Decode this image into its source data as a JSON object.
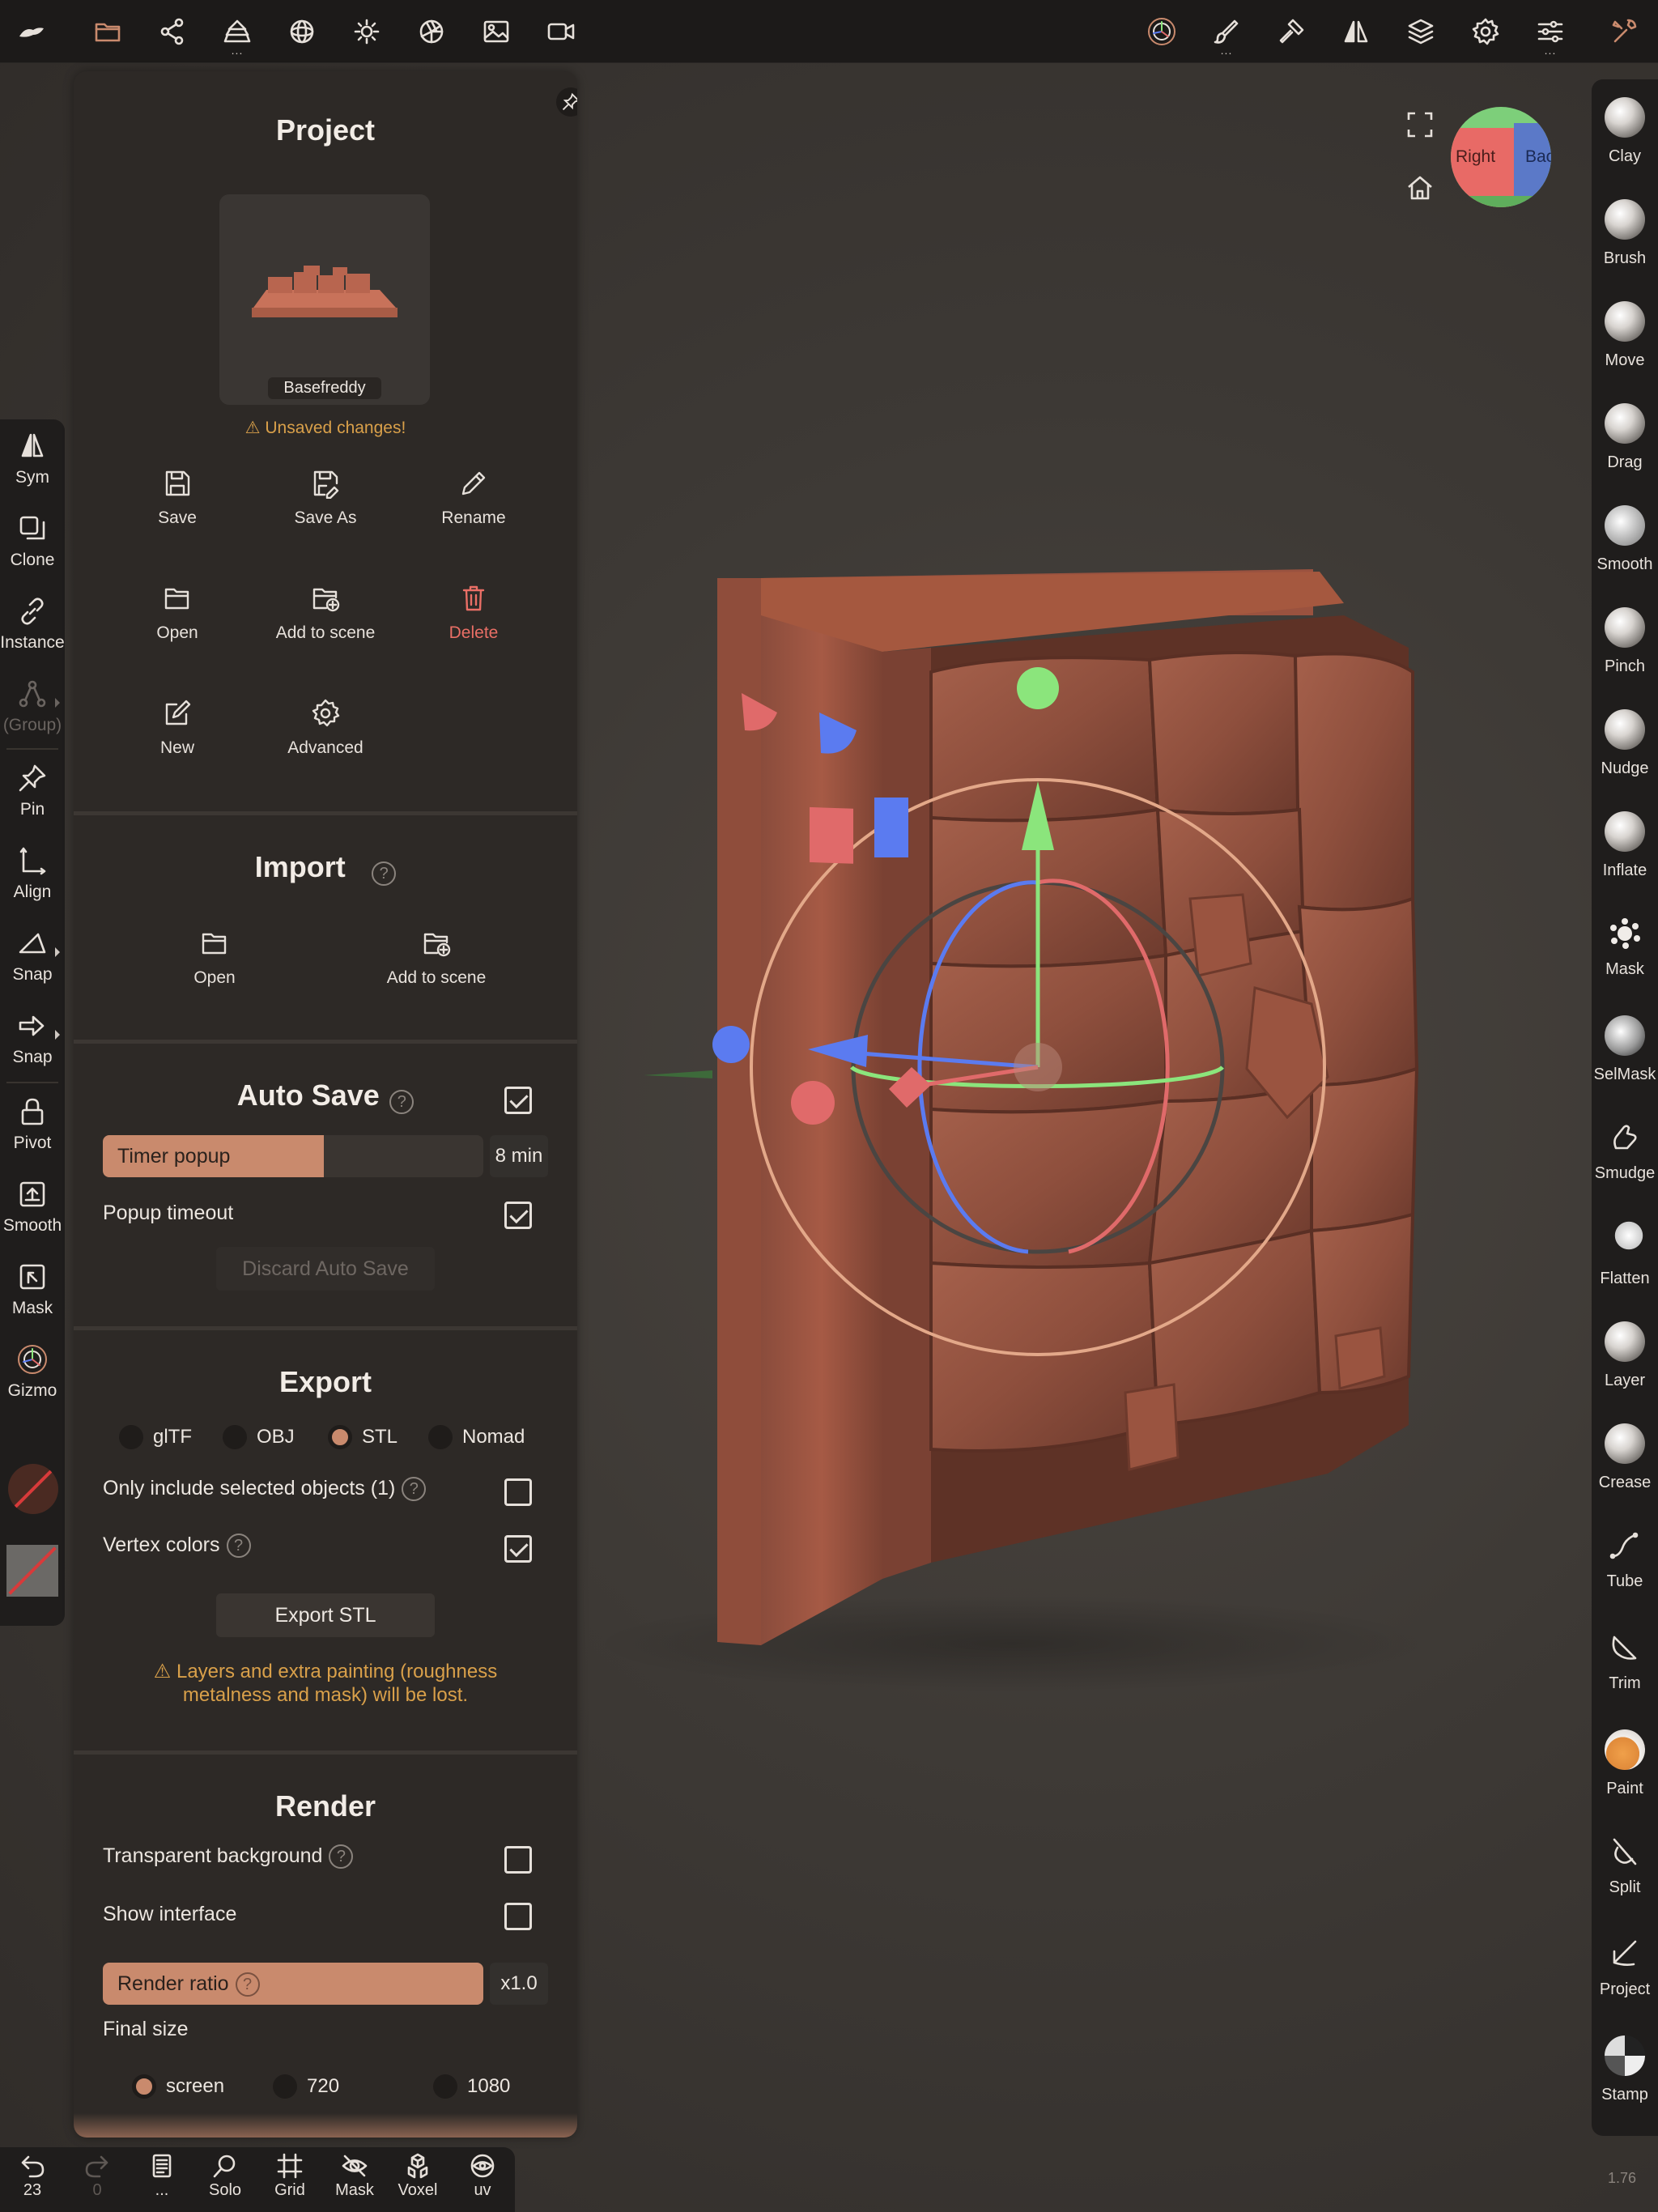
{
  "topbar": {
    "icons": [
      "nomad-logo-icon",
      "folder-icon",
      "scene-graph-icon",
      "layers-stack-icon",
      "material-sphere-icon",
      "light-sun-icon",
      "camera-aperture-icon",
      "image-icon",
      "video-camera-icon",
      "gizmo-icon",
      "paint-brush-icon",
      "sculpt-hammer-icon",
      "symmetry-icon",
      "layers-icon",
      "settings-gear-icon",
      "sliders-icon",
      "tools-icon"
    ]
  },
  "left_rail": {
    "items": [
      {
        "label": "Sym",
        "icon": "symmetry-icon"
      },
      {
        "label": "Clone",
        "icon": "clone-icon"
      },
      {
        "label": "Instance",
        "icon": "link-icon"
      },
      {
        "label": "(Group)",
        "icon": "group-icon"
      },
      {
        "label": "Pin",
        "icon": "pin-icon"
      },
      {
        "label": "Align",
        "icon": "align-icon"
      },
      {
        "label": "Snap",
        "icon": "snap-angle-icon"
      },
      {
        "label": "Snap",
        "icon": "snap-arrow-icon"
      },
      {
        "label": "Pivot",
        "icon": "lock-icon"
      },
      {
        "label": "Smooth",
        "icon": "smooth-icon"
      },
      {
        "label": "Mask",
        "icon": "mask-icon"
      },
      {
        "label": "Gizmo",
        "icon": "gizmo-icon"
      }
    ]
  },
  "panel": {
    "project": {
      "title": "Project",
      "thumbnail_name": "Basefreddy",
      "unsaved_warning": "⚠ Unsaved changes!",
      "actions": [
        {
          "label": "Save",
          "icon": "save-icon"
        },
        {
          "label": "Save As",
          "icon": "save-as-icon"
        },
        {
          "label": "Rename",
          "icon": "pencil-icon"
        },
        {
          "label": "Open",
          "icon": "folder-open-icon"
        },
        {
          "label": "Add to scene",
          "icon": "folder-add-icon"
        },
        {
          "label": "Delete",
          "icon": "trash-icon"
        },
        {
          "label": "New",
          "icon": "new-file-icon"
        },
        {
          "label": "Advanced",
          "icon": "gear-icon"
        }
      ]
    },
    "import": {
      "title": "Import",
      "help": "?",
      "actions": [
        {
          "label": "Open",
          "icon": "folder-open-icon"
        },
        {
          "label": "Add to scene",
          "icon": "folder-add-icon"
        }
      ]
    },
    "autosave": {
      "title": "Auto Save",
      "help": "?",
      "enabled": true,
      "timer_label": "Timer popup",
      "timer_value": "8 min",
      "timer_fill": 0.58,
      "popup_timeout_label": "Popup timeout",
      "popup_timeout": true,
      "discard_label": "Discard Auto Save"
    },
    "export": {
      "title": "Export",
      "formats": [
        "glTF",
        "OBJ",
        "STL",
        "Nomad"
      ],
      "selected_format": "STL",
      "only_selected_label": "Only include selected objects (1)",
      "only_selected": false,
      "vertex_colors_label": "Vertex colors",
      "vertex_colors": true,
      "export_button": "Export STL",
      "warning_line1": "⚠ Layers and extra painting (roughness",
      "warning_line2": "metalness and mask) will be lost."
    },
    "render": {
      "title": "Render",
      "transparent_bg_label": "Transparent background",
      "transparent_bg": false,
      "show_interface_label": "Show interface",
      "show_interface": false,
      "render_ratio_label": "Render ratio",
      "render_ratio_value": "x1.0",
      "render_ratio_fill": 1.0,
      "final_size_label": "Final size",
      "sizes": [
        "screen",
        "720",
        "1080"
      ],
      "selected_size": "screen"
    }
  },
  "viewport": {
    "view_cube_front": "Right",
    "view_cube_side": "Back"
  },
  "right_rail": {
    "brushes": [
      "Clay",
      "Brush",
      "Move",
      "Drag",
      "Smooth",
      "Pinch",
      "Nudge",
      "Inflate",
      "Mask",
      "SelMask",
      "Smudge",
      "Flatten",
      "Layer",
      "Crease",
      "Tube",
      "Trim",
      "Paint",
      "Split",
      "Project",
      "Stamp"
    ]
  },
  "bottom_bar": {
    "items": [
      {
        "label": "23",
        "icon": "undo-icon"
      },
      {
        "label": "0",
        "icon": "redo-icon"
      },
      {
        "label": "...",
        "icon": "notebook-icon"
      },
      {
        "label": "Solo",
        "icon": "search-icon"
      },
      {
        "label": "Grid",
        "icon": "grid-icon"
      },
      {
        "label": "Mask",
        "icon": "eye-hidden-icon"
      },
      {
        "label": "Voxel",
        "icon": "voxel-icon"
      },
      {
        "label": "uv",
        "icon": "uv-eye-icon"
      }
    ]
  },
  "version": "1.76",
  "colors": {
    "accent": "#c98a6d",
    "warning": "#d9a04a",
    "delete": "#ea6f66",
    "panel_bg": "#2d2926",
    "toolbar_bg": "#1c1a19"
  }
}
